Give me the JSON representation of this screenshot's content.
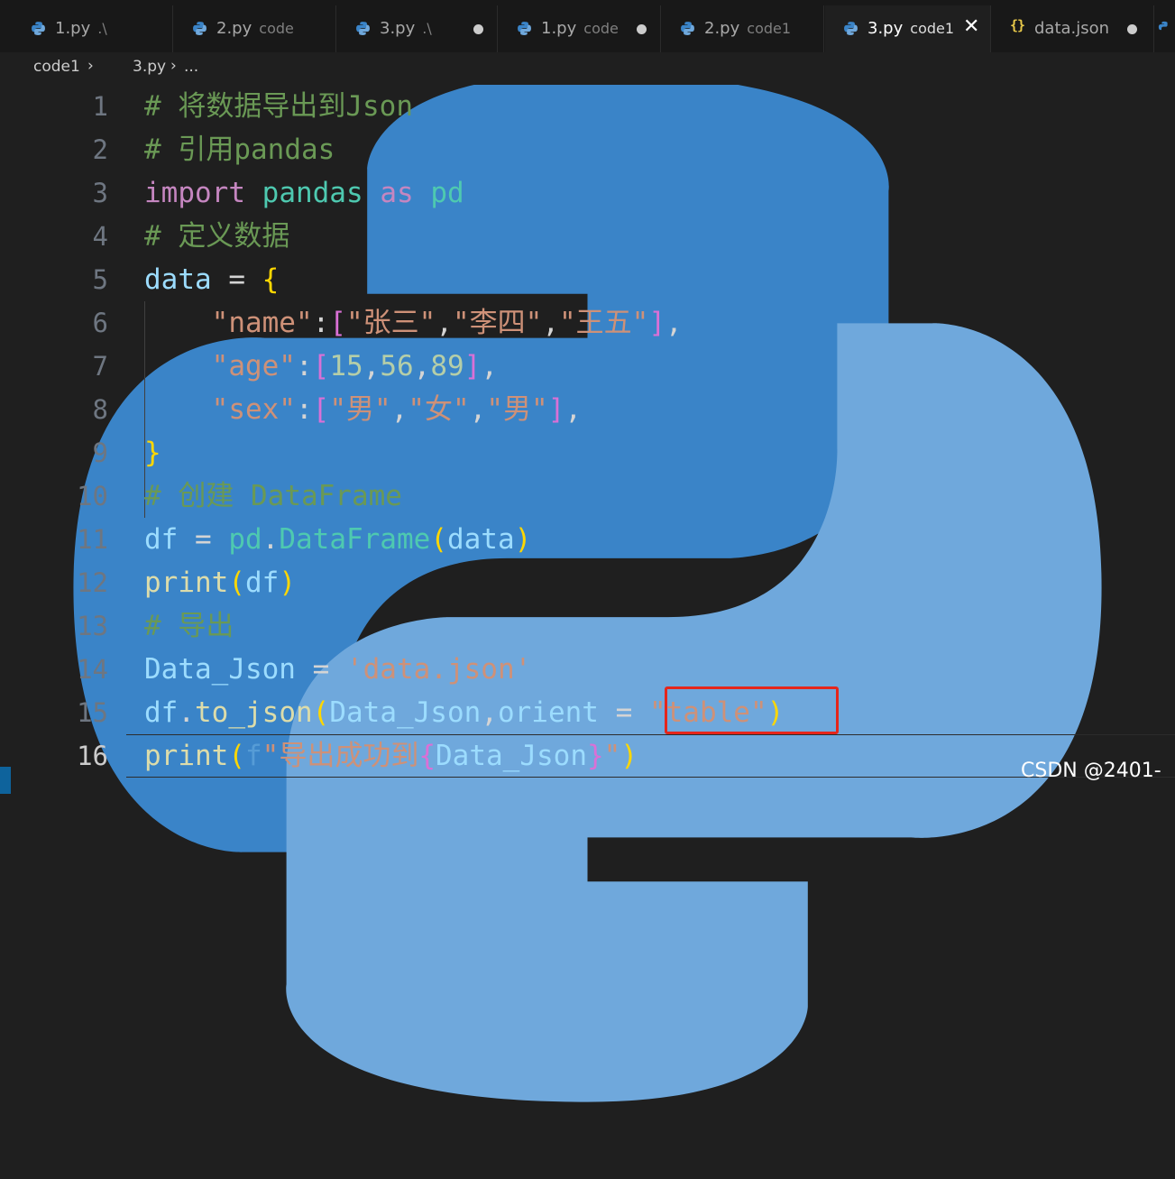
{
  "tabs": [
    {
      "name": "1.py",
      "desc": ".\\",
      "icon": "python-icon",
      "dirty": false,
      "active": false
    },
    {
      "name": "2.py",
      "desc": "code",
      "icon": "python-icon",
      "dirty": false,
      "active": false
    },
    {
      "name": "3.py",
      "desc": ".\\",
      "icon": "python-icon",
      "dirty": true,
      "active": false
    },
    {
      "name": "1.py",
      "desc": "code",
      "icon": "python-icon",
      "dirty": true,
      "active": false
    },
    {
      "name": "2.py",
      "desc": "code1",
      "icon": "python-icon",
      "dirty": false,
      "active": false
    },
    {
      "name": "3.py",
      "desc": "code1",
      "icon": "python-icon",
      "dirty": false,
      "active": true
    },
    {
      "name": "data.json",
      "desc": "",
      "icon": "json-braces-icon",
      "dirty": true,
      "active": false
    }
  ],
  "tab_close_glyph": "✕",
  "breadcrumb": {
    "folder": "code1",
    "file": "3.py",
    "more": "..."
  },
  "line_numbers": [
    "1",
    "2",
    "3",
    "4",
    "5",
    "6",
    "7",
    "8",
    "9",
    "10",
    "11",
    "12",
    "13",
    "14",
    "15",
    "16"
  ],
  "current_line": "16",
  "code": {
    "l1": {
      "comment": "# 将数据导出到Json"
    },
    "l2": {
      "comment": "# 引用pandas"
    },
    "l3": {
      "kw_import": "import",
      "module": "pandas",
      "kw_as": "as",
      "alias": "pd"
    },
    "l4": {
      "comment": "# 定义数据"
    },
    "l5": {
      "var": "data",
      "op": " = ",
      "brace": "{"
    },
    "l6": {
      "indent": "    ",
      "key": "\"name\"",
      "colon": ":",
      "open": "[",
      "s1": "\"张三\"",
      "c1": ",",
      "s2": "\"李四\"",
      "c2": ",",
      "s3": "\"王五\"",
      "close": "]",
      "trail": ","
    },
    "l7": {
      "indent": "    ",
      "key": "\"age\"",
      "colon": ":",
      "open": "[",
      "n1": "15",
      "c1": ",",
      "n2": "56",
      "c2": ",",
      "n3": "89",
      "close": "]",
      "trail": ","
    },
    "l8": {
      "indent": "    ",
      "key": "\"sex\"",
      "colon": ":",
      "open": "[",
      "s1": "\"男\"",
      "c1": ",",
      "s2": "\"女\"",
      "c2": ",",
      "s3": "\"男\"",
      "close": "]",
      "trail": ","
    },
    "l9": {
      "brace": "}"
    },
    "l10": {
      "comment": "# 创建 DataFrame"
    },
    "l11": {
      "var": "df",
      "op": " = ",
      "obj": "pd",
      "dot": ".",
      "cls": "DataFrame",
      "open": "(",
      "arg": "data",
      "close": ")"
    },
    "l12": {
      "fn": "print",
      "open": "(",
      "arg": "df",
      "close": ")"
    },
    "l13": {
      "comment": "# 导出"
    },
    "l14": {
      "var": "Data_Json",
      "op": " = ",
      "str": "'data.json'"
    },
    "l15": {
      "obj": "df",
      "dot": ".",
      "fn": "to_json",
      "open": "(",
      "arg1": "Data_Json",
      "comma": ",",
      "param": "orient",
      "op": " = ",
      "str": "\"table\"",
      "close": ")"
    },
    "l16": {
      "fn": "print",
      "open": "(",
      "fpre": "f",
      "s1": "\"导出成功到",
      "lb": "{",
      "var": "Data_Json",
      "rb": "}",
      "s2": "\"",
      "close": ")"
    }
  },
  "watermark": "CSDN @2401-",
  "colors": {
    "comment": "#6a9955",
    "keyword": "#c586c0",
    "module": "#4ec9b0",
    "variable": "#9cdcfe",
    "function": "#dcdcaa",
    "string": "#ce9178",
    "number": "#b5cea8",
    "bracket1": "#ffd700",
    "bracket2": "#da70d6",
    "bracket3": "#179fff",
    "annotation_box": "#e5261c"
  }
}
